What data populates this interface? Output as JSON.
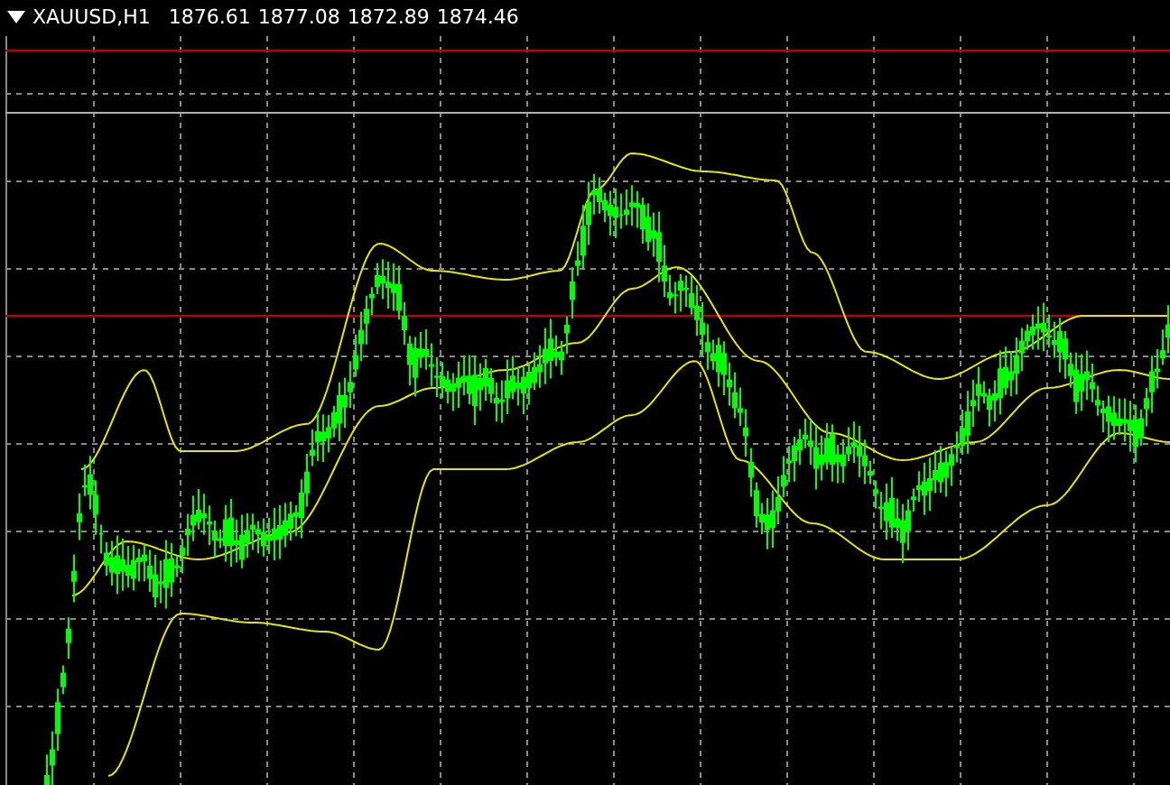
{
  "chart_window": {
    "symbol": "XAUUSD,H1",
    "quotes": [
      "1876.61",
      "1877.08",
      "1872.89",
      "1874.46"
    ]
  }
}
